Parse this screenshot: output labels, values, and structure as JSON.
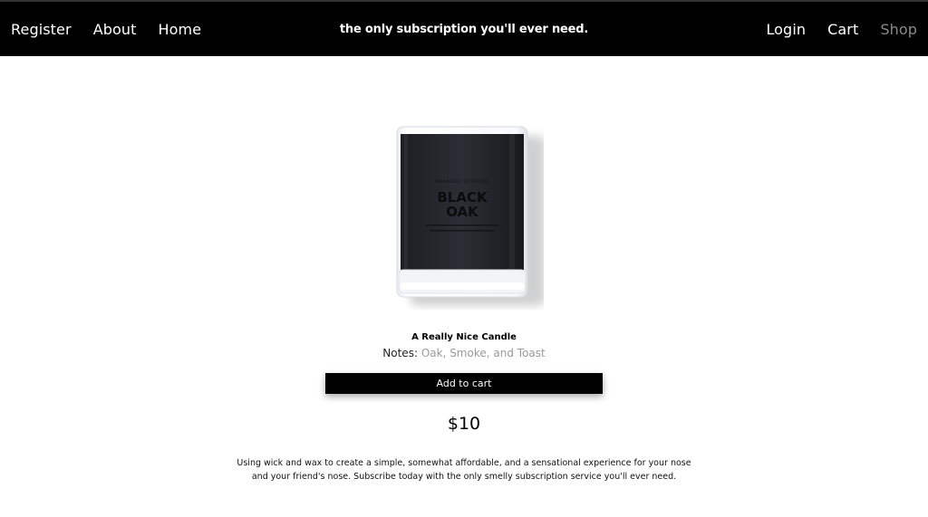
{
  "nav": {
    "left": [
      "Register",
      "About",
      "Home"
    ],
    "right": [
      "Login",
      "Cart",
      "Shop"
    ],
    "tagline": "the only subscription you'll ever need."
  },
  "product": {
    "label_brand": "BRANDED SCENTED",
    "label_name_line1": "BLACK",
    "label_name_line2": "OAK",
    "title": "A Really Nice Candle",
    "notes_label": "Notes:",
    "notes_value": "Oak, Smoke, and Toast",
    "add_to_cart": "Add to cart",
    "price": "$10",
    "description": "Using wick and wax to create a simple, somewhat affordable, and a sensational experience for your nose and your friend's nose. Subscribe today with the only smelly subscription service you'll ever need."
  },
  "colors": {
    "header_bg": "#000000",
    "inactive_nav": "#8a8a8a",
    "notes_value": "#9a9a9a"
  }
}
